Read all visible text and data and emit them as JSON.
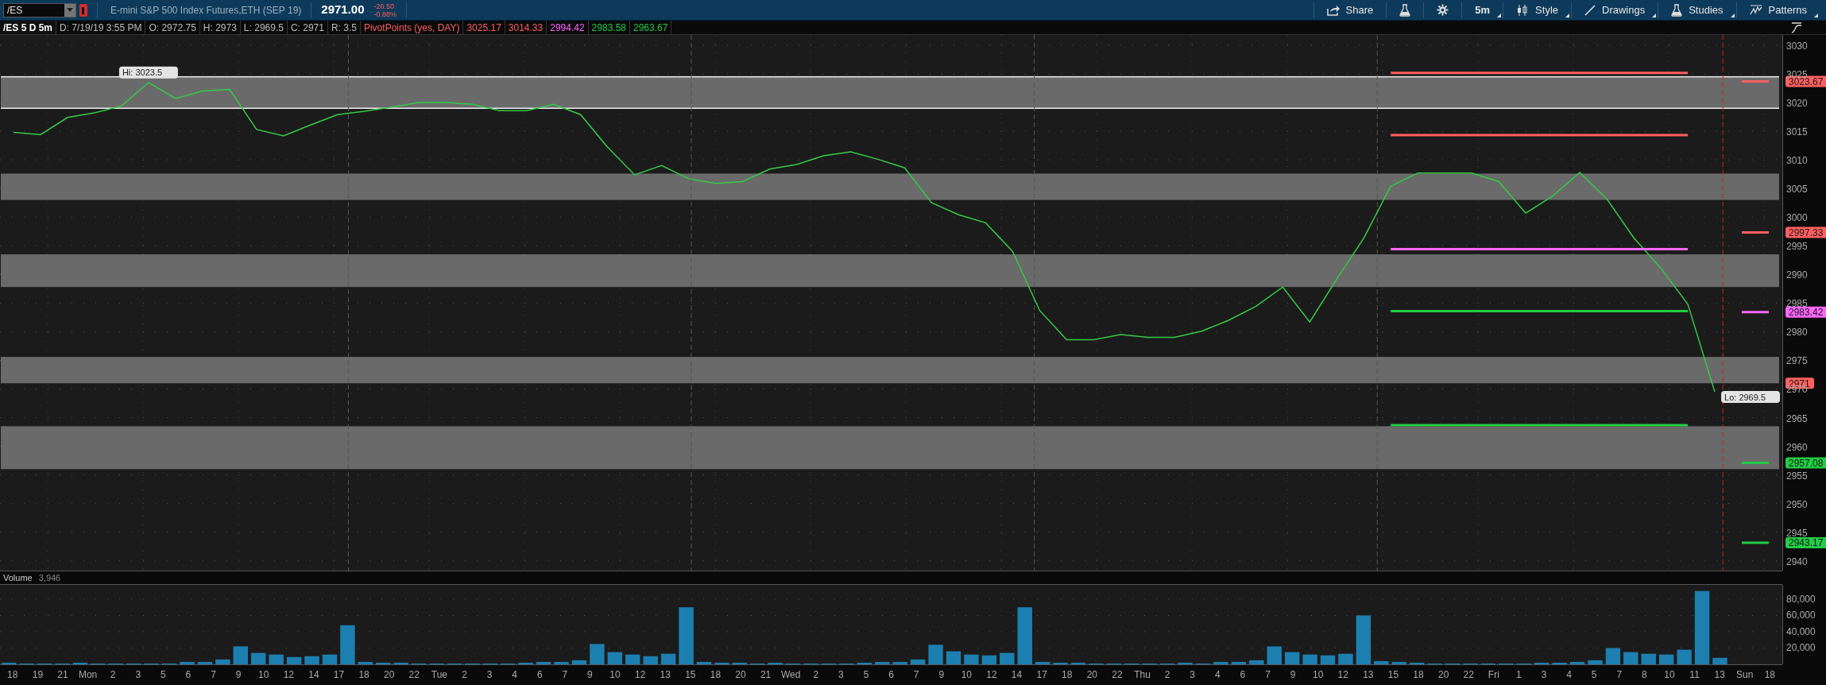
{
  "toolbar": {
    "symbol": "/ES",
    "description": "E-mini S&P 500 Index Futures,ETH (SEP 19)",
    "last": "2971.00",
    "change": "-26.50",
    "change_pct": "-0.88%",
    "buttons": [
      {
        "label": "Share",
        "menu": false
      },
      {
        "menu": false
      },
      {
        "menu": false
      },
      {
        "label": "5m",
        "menu": true
      },
      {
        "label": "Style",
        "menu": true
      },
      {
        "label": "Drawings",
        "menu": true
      },
      {
        "label": "Studies",
        "menu": true
      },
      {
        "label": "Patterns",
        "menu": true
      }
    ]
  },
  "study_header": {
    "chart": "/ES 5 D 5m",
    "fields": [
      "D: 7/19/19 3:55 PM",
      "O: 2972.75",
      "H: 2973",
      "L: 2969.5",
      "C: 2971",
      "R: 3.5"
    ],
    "study": "PivotPoints (yes, DAY)",
    "values": [
      {
        "text": "3025.17",
        "color": "#ff5f5f"
      },
      {
        "text": "3014.33",
        "color": "#ff5f5f"
      },
      {
        "text": "2994.42",
        "color": "#ff66ff"
      },
      {
        "text": "2983.58",
        "color": "#22cc44"
      },
      {
        "text": "2963.67",
        "color": "#22cc44"
      }
    ]
  },
  "price_chart": {
    "chart_data": {
      "type": "line",
      "ylim": [
        2938.3,
        3031.8
      ],
      "grid": true,
      "categories": [
        null,
        null,
        null,
        null,
        null,
        null,
        null,
        null,
        null,
        null,
        null,
        null,
        null,
        null,
        null,
        null,
        null,
        null,
        null,
        null,
        null,
        null,
        null,
        null,
        null,
        null,
        null,
        null,
        null,
        null,
        null,
        null,
        null,
        null,
        null,
        null,
        null,
        null,
        null,
        null,
        null,
        null,
        null,
        null,
        null,
        null,
        null,
        null,
        null,
        null,
        null,
        null,
        null,
        null,
        null,
        null,
        null,
        null,
        null,
        null,
        null,
        null,
        null,
        null,
        null,
        null
      ],
      "yticks": [
        2940,
        2945,
        2950,
        2955,
        2960,
        2965,
        2970,
        2975,
        2980,
        2985,
        2990,
        2995,
        3000,
        3005,
        3010,
        3015,
        3020,
        3025,
        3030
      ],
      "series": [
        {
          "color": "#33cc44",
          "values": [
            3014.8,
            3014.4,
            3017.4,
            3018.2,
            3019.4,
            3023.5,
            3020.7,
            3022,
            3022.3,
            3015.3,
            3014.2,
            3016.1,
            3017.9,
            3018.5,
            3019.2,
            3020,
            3020,
            3019.7,
            3018.6,
            3018.6,
            3019.7,
            3017.9,
            3012.2,
            3007.4,
            3009,
            3006.7,
            3005.9,
            3006.2,
            3008.4,
            3009.2,
            3010.7,
            3011.4,
            3010.1,
            3008.6,
            3002.5,
            3000.4,
            2999,
            2994,
            2983.7,
            2978.6,
            2978.6,
            2979.5,
            2979,
            2979,
            2980.1,
            2982,
            2984.4,
            2987.8,
            2981.7,
            2989.2,
            2996.3,
            3005.4,
            3007.7,
            3007.7,
            3007.7,
            3006.2,
            3000.7,
            3003.7,
            3007.8,
            3003.2,
            2996.4,
            2991.1,
            2984.8,
            2969.5,
            null,
            null
          ]
        },
        {
          "color": "#ff5f5f",
          "values": [
            null,
            null,
            null,
            null,
            null,
            null,
            null,
            null,
            null,
            null,
            null,
            null,
            null,
            null,
            null,
            null,
            null,
            null,
            null,
            null,
            null,
            null,
            null,
            null,
            null,
            null,
            null,
            null,
            null,
            null,
            null,
            null,
            null,
            null,
            null,
            null,
            null,
            null,
            null,
            null,
            null,
            null,
            null,
            null,
            null,
            null,
            null,
            null,
            null,
            null,
            null,
            3025.17,
            3025.17,
            3025.17,
            3025.17,
            3025.17,
            3025.17,
            3025.17,
            3025.17,
            3025.17,
            3025.17,
            3025.17,
            3025.17,
            null,
            3023.67,
            3023.67
          ]
        },
        {
          "color": "#ff5f5f",
          "values": [
            null,
            null,
            null,
            null,
            null,
            null,
            null,
            null,
            null,
            null,
            null,
            null,
            null,
            null,
            null,
            null,
            null,
            null,
            null,
            null,
            null,
            null,
            null,
            null,
            null,
            null,
            null,
            null,
            null,
            null,
            null,
            null,
            null,
            null,
            null,
            null,
            null,
            null,
            null,
            null,
            null,
            null,
            null,
            null,
            null,
            null,
            null,
            null,
            null,
            null,
            null,
            3014.33,
            3014.33,
            3014.33,
            3014.33,
            3014.33,
            3014.33,
            3014.33,
            3014.33,
            3014.33,
            3014.33,
            3014.33,
            3014.33,
            null,
            2997.33,
            2997.33
          ]
        },
        {
          "color": "#ff66ff",
          "values": [
            null,
            null,
            null,
            null,
            null,
            null,
            null,
            null,
            null,
            null,
            null,
            null,
            null,
            null,
            null,
            null,
            null,
            null,
            null,
            null,
            null,
            null,
            null,
            null,
            null,
            null,
            null,
            null,
            null,
            null,
            null,
            null,
            null,
            null,
            null,
            null,
            null,
            null,
            null,
            null,
            null,
            null,
            null,
            null,
            null,
            null,
            null,
            null,
            null,
            null,
            null,
            2994.42,
            2994.42,
            2994.42,
            2994.42,
            2994.42,
            2994.42,
            2994.42,
            2994.42,
            2994.42,
            2994.42,
            2994.42,
            2994.42,
            null,
            2983.42,
            2983.42
          ]
        },
        {
          "color": "#22cc44",
          "values": [
            null,
            null,
            null,
            null,
            null,
            null,
            null,
            null,
            null,
            null,
            null,
            null,
            null,
            null,
            null,
            null,
            null,
            null,
            null,
            null,
            null,
            null,
            null,
            null,
            null,
            null,
            null,
            null,
            null,
            null,
            null,
            null,
            null,
            null,
            null,
            null,
            null,
            null,
            null,
            null,
            null,
            null,
            null,
            null,
            null,
            null,
            null,
            null,
            null,
            null,
            null,
            2983.58,
            2983.58,
            2983.58,
            2983.58,
            2983.58,
            2983.58,
            2983.58,
            2983.58,
            2983.58,
            2983.58,
            2983.58,
            2983.58,
            null,
            2957.08,
            2957.08
          ]
        },
        {
          "color": "#22cc44",
          "values": [
            null,
            null,
            null,
            null,
            null,
            null,
            null,
            null,
            null,
            null,
            null,
            null,
            null,
            null,
            null,
            null,
            null,
            null,
            null,
            null,
            null,
            null,
            null,
            null,
            null,
            null,
            null,
            null,
            null,
            null,
            null,
            null,
            null,
            null,
            null,
            null,
            null,
            null,
            null,
            null,
            null,
            null,
            null,
            null,
            null,
            null,
            null,
            null,
            null,
            null,
            null,
            2963.67,
            2963.67,
            2963.67,
            2963.67,
            2963.67,
            2963.67,
            2963.67,
            2963.67,
            2963.67,
            2963.67,
            2963.67,
            2963.67,
            null,
            2943.17,
            2943.17
          ]
        }
      ],
      "bands": [
        {
          "axis": "y",
          "from": 3019,
          "to": 3024.5
        },
        {
          "axis": "y",
          "from": 3003,
          "to": 3007.6
        },
        {
          "axis": "y",
          "from": 2987.8,
          "to": 2993.5
        },
        {
          "axis": "y",
          "from": 2971,
          "to": 2975.6
        },
        {
          "axis": "y",
          "from": 2956,
          "to": 2963.5
        }
      ],
      "ref_lines": [
        {
          "axis": "y",
          "value": 3024.5,
          "color": "#f0f0f0"
        },
        {
          "axis": "y",
          "value": 3019,
          "color": "#f0f0f0"
        }
      ],
      "annotations": [
        "Hi: 3023.5",
        "Lo: 2969.5"
      ]
    },
    "price_tags": [
      {
        "text": "3023.67",
        "color": "#ff5f5f"
      },
      {
        "text": "2997.33",
        "color": "#ff5f5f"
      },
      {
        "text": "2983.42",
        "color": "#ff66ff"
      },
      {
        "text": "2971",
        "color": "#ff5f5f"
      },
      {
        "text": "2957.08",
        "color": "#22cc44"
      },
      {
        "text": "2943.17",
        "color": "#22cc44"
      }
    ]
  },
  "volume": {
    "title": "Volume",
    "value": "3,946",
    "chart_data": {
      "type": "bar",
      "ylim": [
        0,
        97500
      ],
      "grid": true,
      "yticks": [
        {
          "value": 20000,
          "label": "20,000"
        },
        {
          "value": 40000,
          "label": "40,000"
        },
        {
          "value": 60000,
          "label": "60,000"
        },
        {
          "value": 80000,
          "label": "80,000"
        }
      ],
      "values": [
        2000,
        1000,
        1000,
        1000,
        2000,
        1000,
        1000,
        1000,
        1000,
        1000,
        3000,
        3000,
        6000,
        22000,
        14000,
        12000,
        9000,
        10000,
        12000,
        48000,
        3000,
        2000,
        2000,
        1000,
        1000,
        1000,
        1000,
        1000,
        1000,
        2000,
        3000,
        3000,
        5000,
        25000,
        15000,
        12000,
        10000,
        13000,
        70000,
        3000,
        2000,
        2000,
        1000,
        2000,
        1000,
        1000,
        1000,
        1000,
        2000,
        3000,
        3000,
        6000,
        24000,
        16000,
        12000,
        11000,
        14000,
        70000,
        3000,
        2000,
        2000,
        1000,
        1000,
        1000,
        1000,
        1000,
        2000,
        1000,
        3000,
        3000,
        5000,
        22000,
        15000,
        12000,
        11000,
        13000,
        60000,
        4000,
        3000,
        2000,
        1000,
        1000,
        1000,
        1000,
        1000,
        1000,
        2000,
        2000,
        3000,
        5000,
        20000,
        15000,
        13000,
        12000,
        18000,
        90000,
        8000,
        null,
        null,
        null
      ]
    }
  },
  "time_axis": [
    "18",
    "19",
    "21",
    "Mon",
    "2",
    "3",
    "5",
    "6",
    "7",
    "9",
    "10",
    "12",
    "14",
    "17",
    "18",
    "20",
    "22",
    "Tue",
    "2",
    "3",
    "4",
    "6",
    "7",
    "9",
    "10",
    "12",
    "13",
    "15",
    "18",
    "20",
    "21",
    "Wed",
    "2",
    "3",
    "5",
    "6",
    "7",
    "9",
    "10",
    "12",
    "14",
    "17",
    "18",
    "20",
    "22",
    "Thu",
    "2",
    "3",
    "4",
    "6",
    "7",
    "9",
    "10",
    "12",
    "13",
    "15",
    "18",
    "20",
    "22",
    "Fri",
    "1",
    "3",
    "4",
    "5",
    "7",
    "8",
    "10",
    "11",
    "13",
    "Sun",
    "18"
  ]
}
